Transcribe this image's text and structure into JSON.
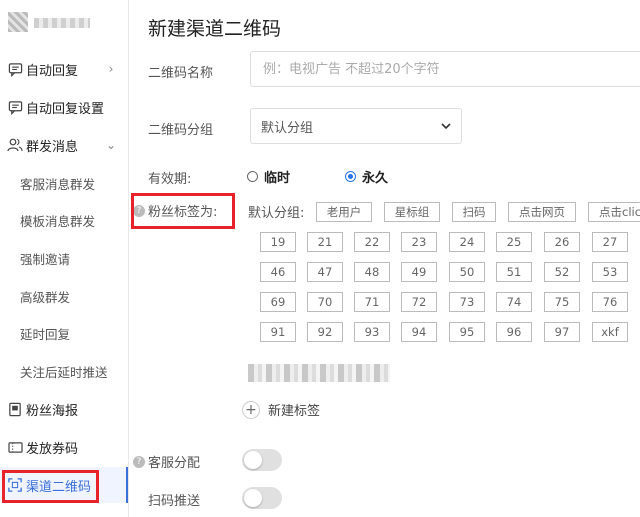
{
  "sidebar": {
    "items": [
      {
        "label": "自动回复",
        "icon": "chat-bubble-icon",
        "chevron": "›"
      },
      {
        "label": "自动回复设置",
        "icon": "chat-bubble-icon"
      },
      {
        "label": "群发消息",
        "icon": "users-icon",
        "chevron": "⌄"
      },
      {
        "label": "客服消息群发"
      },
      {
        "label": "模板消息群发"
      },
      {
        "label": "强制邀请"
      },
      {
        "label": "高级群发"
      },
      {
        "label": "延时回复"
      },
      {
        "label": "关注后延时推送"
      },
      {
        "label": "粉丝海报",
        "icon": "poster-icon"
      },
      {
        "label": "发放券码",
        "icon": "ticket-icon"
      },
      {
        "label": "渠道二维码",
        "icon": "qrcode-icon",
        "active": true
      }
    ]
  },
  "page": {
    "title": "新建渠道二维码",
    "name_label": "二维码名称",
    "name_placeholder": "例：电视广告 不超过20个字符",
    "group_label": "二维码分组",
    "group_value": "默认分组",
    "validity_label": "有效期:",
    "validity_temp": "临时",
    "validity_perm": "永久",
    "fans_tag_label": "粉丝标签为:",
    "default_group_label": "默认分组:",
    "tags_row1": [
      "老用户",
      "星标组",
      "扫码",
      "点击网页",
      "点击click"
    ],
    "tags_grid": [
      "19",
      "21",
      "22",
      "23",
      "24",
      "25",
      "26",
      "27",
      "46",
      "47",
      "48",
      "49",
      "50",
      "51",
      "52",
      "53",
      "69",
      "70",
      "71",
      "72",
      "73",
      "74",
      "75",
      "76",
      "91",
      "92",
      "93",
      "94",
      "95",
      "96",
      "97",
      "xkf"
    ],
    "add_tag": "新建标签",
    "service_assign": "客服分配",
    "scan_push": "扫码推送"
  },
  "colors": {
    "accent": "#2b73e8",
    "highlight": "#e8222b"
  }
}
